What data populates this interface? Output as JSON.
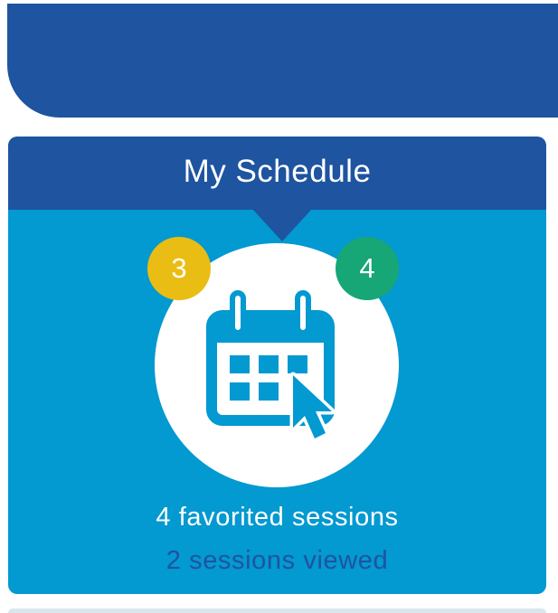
{
  "card": {
    "title": "My Schedule",
    "favorited_text": "4 favorited sessions",
    "viewed_text": "2 sessions viewed"
  },
  "badges": {
    "left_count": "3",
    "right_count": "4"
  },
  "icons": {
    "main": "calendar-cursor-icon"
  },
  "colors": {
    "dark_blue": "#1e54a0",
    "light_blue": "#0399d1",
    "yellow": "#eabd14",
    "green": "#17a676",
    "white": "#ffffff"
  }
}
